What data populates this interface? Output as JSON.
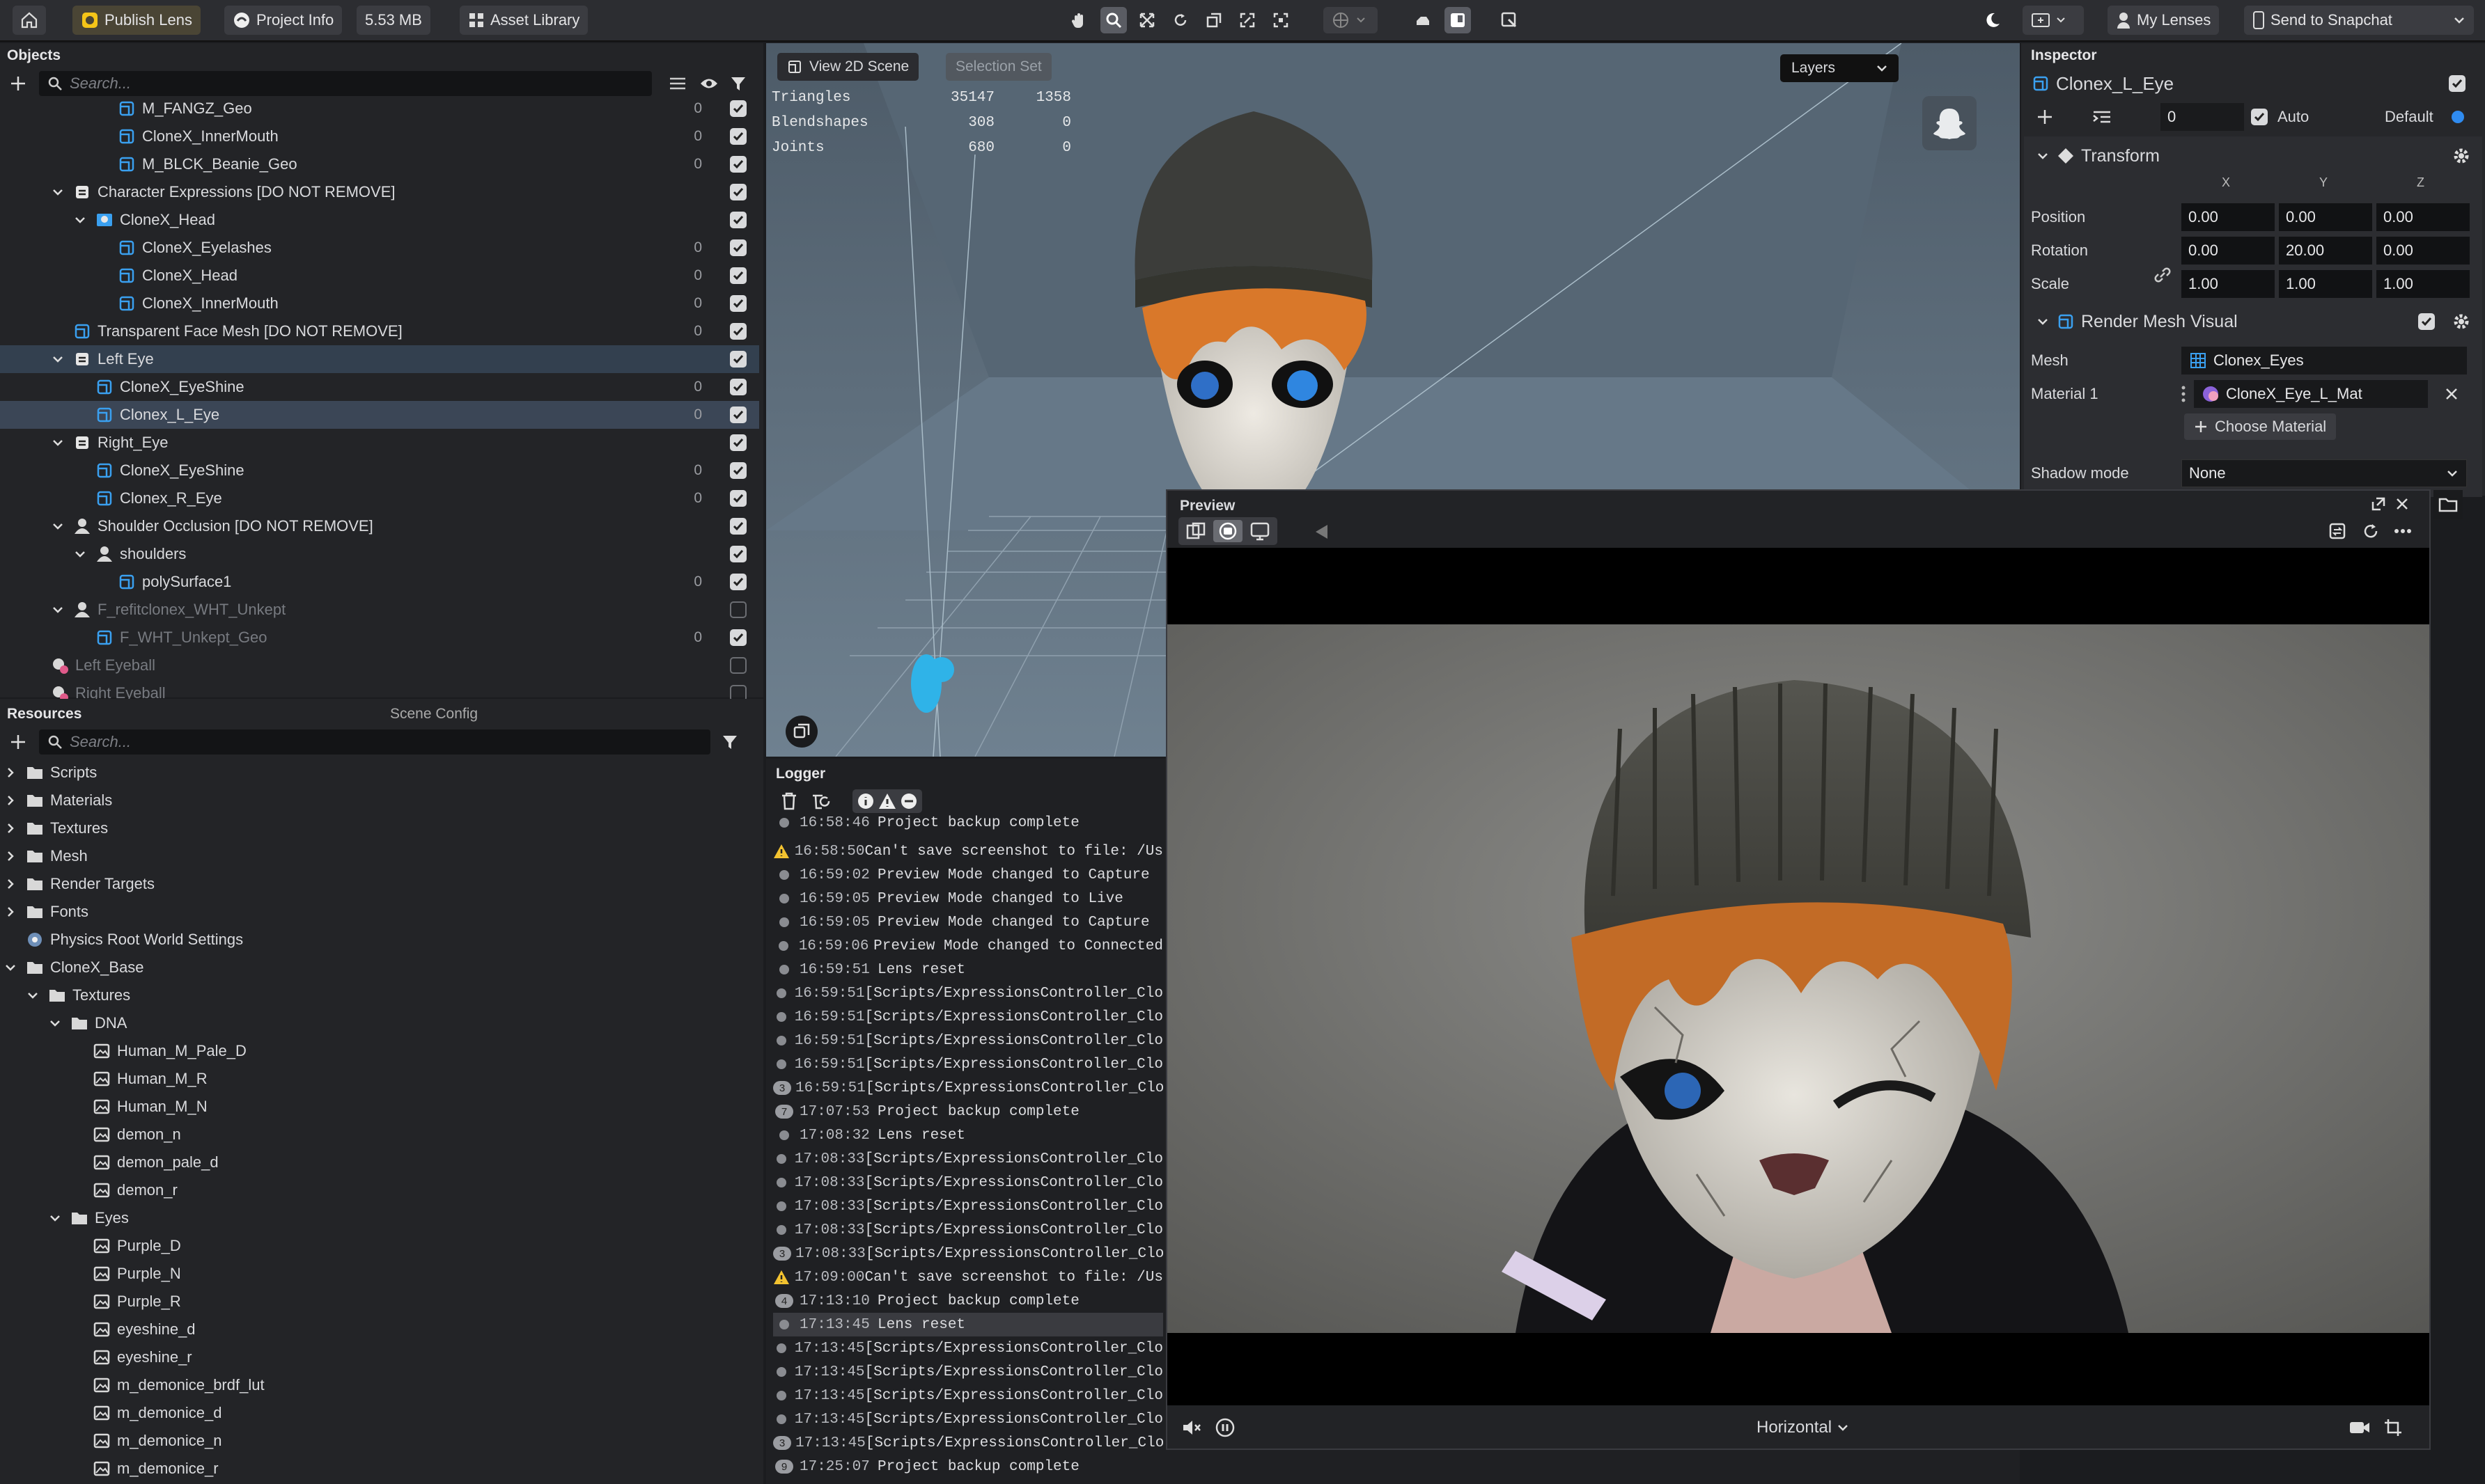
{
  "topbar": {
    "publish": "Publish Lens",
    "project_info": "Project Info",
    "size": "5.53 MB",
    "asset_library": "Asset Library",
    "my_lenses": "My Lenses",
    "send": "Send to Snapchat"
  },
  "objects": {
    "title": "Objects",
    "search_placeholder": "Search...",
    "rows": [
      {
        "label": "M_FANGZ_Geo",
        "count": "0",
        "icon": "mesh-icon",
        "on": true
      },
      {
        "label": "CloneX_InnerMouth",
        "count": "0",
        "icon": "mesh-icon",
        "on": true
      },
      {
        "label": "M_BLCK_Beanie_Geo",
        "count": "0",
        "icon": "mesh-icon",
        "on": true
      },
      {
        "label": "Character Expressions [DO NOT REMOVE]",
        "count": "",
        "icon": "scene-object-icon",
        "on": true
      },
      {
        "label": "CloneX_Head",
        "count": "",
        "icon": "head-icon",
        "on": true
      },
      {
        "label": "CloneX_Eyelashes",
        "count": "0",
        "icon": "mesh-icon",
        "on": true
      },
      {
        "label": "CloneX_Head",
        "count": "0",
        "icon": "mesh-icon",
        "on": true
      },
      {
        "label": "CloneX_InnerMouth",
        "count": "0",
        "icon": "mesh-icon",
        "on": true
      },
      {
        "label": "Transparent Face Mesh [DO NOT REMOVE]",
        "count": "0",
        "icon": "mesh-icon",
        "on": true
      },
      {
        "label": "Left Eye",
        "count": "",
        "icon": "scene-object-icon",
        "on": true
      },
      {
        "label": "CloneX_EyeShine",
        "count": "0",
        "icon": "mesh-icon",
        "on": true
      },
      {
        "label": "Clonex_L_Eye",
        "count": "0",
        "icon": "mesh-icon",
        "on": true
      },
      {
        "label": "Right_Eye",
        "count": "",
        "icon": "scene-object-icon",
        "on": true
      },
      {
        "label": "CloneX_EyeShine",
        "count": "0",
        "icon": "mesh-icon",
        "on": true
      },
      {
        "label": "Clonex_R_Eye",
        "count": "0",
        "icon": "mesh-icon",
        "on": true
      },
      {
        "label": "Shoulder Occlusion [DO NOT REMOVE]",
        "count": "",
        "icon": "body-icon",
        "on": true
      },
      {
        "label": "shoulders",
        "count": "",
        "icon": "body-icon",
        "on": true
      },
      {
        "label": "polySurface1",
        "count": "0",
        "icon": "mesh-icon",
        "on": true
      },
      {
        "label": "F_refitclonex_WHT_Unkept",
        "count": "",
        "icon": "body-icon",
        "on": false
      },
      {
        "label": "F_WHT_Unkept_Geo",
        "count": "0",
        "icon": "mesh-icon",
        "on": true
      },
      {
        "label": "Left Eyeball",
        "count": "",
        "icon": "tracker-icon",
        "on": false
      },
      {
        "label": "Right Eyeball",
        "count": "",
        "icon": "tracker-icon",
        "on": false
      }
    ]
  },
  "resources": {
    "tab1": "Resources",
    "tab2": "Scene Config",
    "search_placeholder": "Search...",
    "rows": [
      "Scripts",
      "Materials",
      "Textures",
      "Mesh",
      "Render Targets",
      "Fonts",
      "Physics Root World Settings",
      "CloneX_Base",
      "Textures",
      "DNA",
      "Human_M_Pale_D",
      "Human_M_R",
      "Human_M_N",
      "demon_n",
      "demon_pale_d",
      "demon_r",
      "Eyes",
      "Purple_D",
      "Purple_N",
      "Purple_R",
      "eyeshine_d",
      "eyeshine_r",
      "m_demonice_brdf_lut",
      "m_demonice_d",
      "m_demonice_n",
      "m_demonice_r"
    ]
  },
  "viewport": {
    "view2d": "View 2D Scene",
    "selection_set": "Selection Set",
    "layers": "Layers",
    "stats": [
      {
        "k": "Triangles",
        "a": "35147",
        "b": "1358"
      },
      {
        "k": "Blendshapes",
        "a": "308",
        "b": "0"
      },
      {
        "k": "Joints",
        "a": "680",
        "b": "0"
      }
    ]
  },
  "logger": {
    "title": "Logger",
    "rows": [
      {
        "b": "",
        "t": "16:58:46",
        "m": "Project backup complete"
      },
      {
        "b": "warn",
        "t": "16:58:50",
        "m": "Can't save screenshot to file: /Us"
      },
      {
        "b": "",
        "t": "16:59:02",
        "m": "Preview Mode changed to Capture"
      },
      {
        "b": "",
        "t": "16:59:05",
        "m": "Preview Mode changed to Live"
      },
      {
        "b": "",
        "t": "16:59:05",
        "m": "Preview Mode changed to Capture"
      },
      {
        "b": "",
        "t": "16:59:06",
        "m": "Preview Mode changed to Connected"
      },
      {
        "b": "",
        "t": "16:59:51",
        "m": "Lens reset"
      },
      {
        "b": "",
        "t": "16:59:51",
        "m": "[Scripts/ExpressionsController_Clo"
      },
      {
        "b": "",
        "t": "16:59:51",
        "m": "[Scripts/ExpressionsController_Clo"
      },
      {
        "b": "",
        "t": "16:59:51",
        "m": "[Scripts/ExpressionsController_Clo"
      },
      {
        "b": "",
        "t": "16:59:51",
        "m": "[Scripts/ExpressionsController_Clo"
      },
      {
        "b": "3",
        "t": "16:59:51",
        "m": "[Scripts/ExpressionsController_Clo"
      },
      {
        "b": "7",
        "t": "17:07:53",
        "m": "Project backup complete"
      },
      {
        "b": "",
        "t": "17:08:32",
        "m": "Lens reset"
      },
      {
        "b": "",
        "t": "17:08:33",
        "m": "[Scripts/ExpressionsController_Clo"
      },
      {
        "b": "",
        "t": "17:08:33",
        "m": "[Scripts/ExpressionsController_Clo"
      },
      {
        "b": "",
        "t": "17:08:33",
        "m": "[Scripts/ExpressionsController_Clo"
      },
      {
        "b": "",
        "t": "17:08:33",
        "m": "[Scripts/ExpressionsController_Clo"
      },
      {
        "b": "3",
        "t": "17:08:33",
        "m": "[Scripts/ExpressionsController_Clo"
      },
      {
        "b": "warn",
        "t": "17:09:00",
        "m": "Can't save screenshot to file: /Us"
      },
      {
        "b": "4",
        "t": "17:13:10",
        "m": "Project backup complete"
      },
      {
        "b": "",
        "t": "17:13:45",
        "m": "Lens reset"
      },
      {
        "b": "",
        "t": "17:13:45",
        "m": "[Scripts/ExpressionsController_Clo"
      },
      {
        "b": "",
        "t": "17:13:45",
        "m": "[Scripts/ExpressionsController_Clo"
      },
      {
        "b": "",
        "t": "17:13:45",
        "m": "[Scripts/ExpressionsController_Clo"
      },
      {
        "b": "",
        "t": "17:13:45",
        "m": "[Scripts/ExpressionsController_Clo"
      },
      {
        "b": "3",
        "t": "17:13:45",
        "m": "[Scripts/ExpressionsController_Clo"
      },
      {
        "b": "9",
        "t": "17:25:07",
        "m": "Project backup complete"
      }
    ]
  },
  "inspector": {
    "title": "Inspector",
    "object": "Clonex_L_Eye",
    "layer_value": "0",
    "auto": "Auto",
    "default": "Default",
    "transform": "Transform",
    "x": "X",
    "y": "Y",
    "z": "Z",
    "position_label": "Position",
    "position": [
      "0.00",
      "0.00",
      "0.00"
    ],
    "rotation_label": "Rotation",
    "rotation": [
      "0.00",
      "20.00",
      "0.00"
    ],
    "scale_label": "Scale",
    "scale": [
      "1.00",
      "1.00",
      "1.00"
    ],
    "rmv": "Render Mesh Visual",
    "mesh_label": "Mesh",
    "mesh": "Clonex_Eyes",
    "material_label": "Material 1",
    "material": "CloneX_Eye_L_Mat",
    "choose": "Choose Material",
    "shadow_label": "Shadow mode",
    "shadow": "None"
  },
  "preview": {
    "title": "Preview",
    "orientation": "Horizontal"
  }
}
